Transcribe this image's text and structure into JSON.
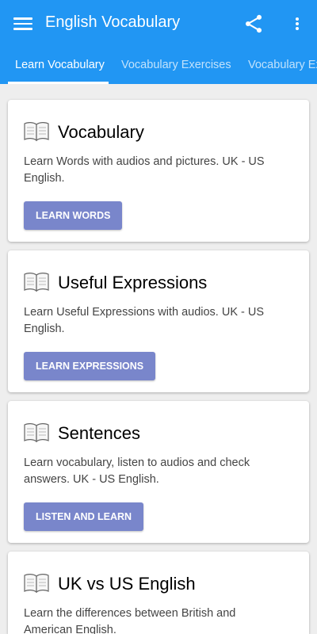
{
  "toolbar": {
    "menu_icon": "hamburger-menu-icon",
    "title": "English Vocabulary",
    "share_icon": "share-icon",
    "more_icon": "more-vert-icon"
  },
  "tabs": [
    {
      "label": "Learn Vocabulary",
      "active": true
    },
    {
      "label": "Vocabulary Exercises",
      "active": false
    },
    {
      "label": "Vocabulary Exercises",
      "active": false
    }
  ],
  "cards": [
    {
      "icon": "open-book-icon",
      "title": "Vocabulary",
      "description": "Learn Words with audios and pictures. UK - US English.",
      "button": "LEARN WORDS"
    },
    {
      "icon": "open-book-icon",
      "title": "Useful Expressions",
      "description": "Learn Useful Expressions with audios. UK - US English.",
      "button": "LEARN EXPRESSIONS"
    },
    {
      "icon": "open-book-icon",
      "title": "Sentences",
      "description": "Learn vocabulary, listen to audios and check answers. UK - US English.",
      "button": "LISTEN AND LEARN"
    },
    {
      "icon": "open-book-icon",
      "title": "UK vs US English",
      "description": "Learn the differences between British and American English."
    }
  ],
  "colors": {
    "app_bar": "#2196f3",
    "button": "#7986cb",
    "background": "#eeeeee"
  }
}
